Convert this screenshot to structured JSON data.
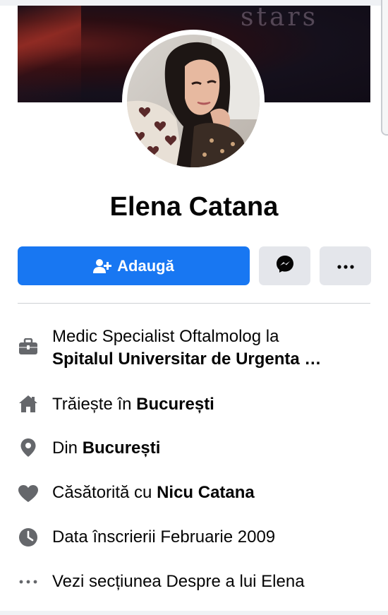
{
  "profile": {
    "name": "Elena Catana",
    "cover_text": "stars"
  },
  "actions": {
    "add_label": "Adaugă",
    "add_icon": "person-add-icon",
    "message_icon": "messenger-icon",
    "more_icon": "more-icon"
  },
  "details": {
    "work": {
      "icon": "briefcase-icon",
      "prefix": "Medic Specialist Oftalmolog la",
      "place": "Spitalul Universitar de Urgenta …"
    },
    "lives": {
      "icon": "home-icon",
      "prefix": "Trăiește în ",
      "place": "București"
    },
    "from": {
      "icon": "location-pin-icon",
      "prefix": "Din ",
      "place": "București"
    },
    "relationship": {
      "icon": "heart-icon",
      "prefix": "Căsătorită cu ",
      "person": "Nicu Catana"
    },
    "joined": {
      "icon": "clock-icon",
      "text": "Data înscrierii Februarie 2009"
    },
    "about": {
      "icon": "more-horizontal-icon",
      "text": "Vezi secțiunea Despre a lui Elena"
    }
  },
  "colors": {
    "primary": "#1877f2",
    "secondary_button": "#e4e6eb",
    "icon_gray": "#65676b",
    "text": "#050505"
  }
}
